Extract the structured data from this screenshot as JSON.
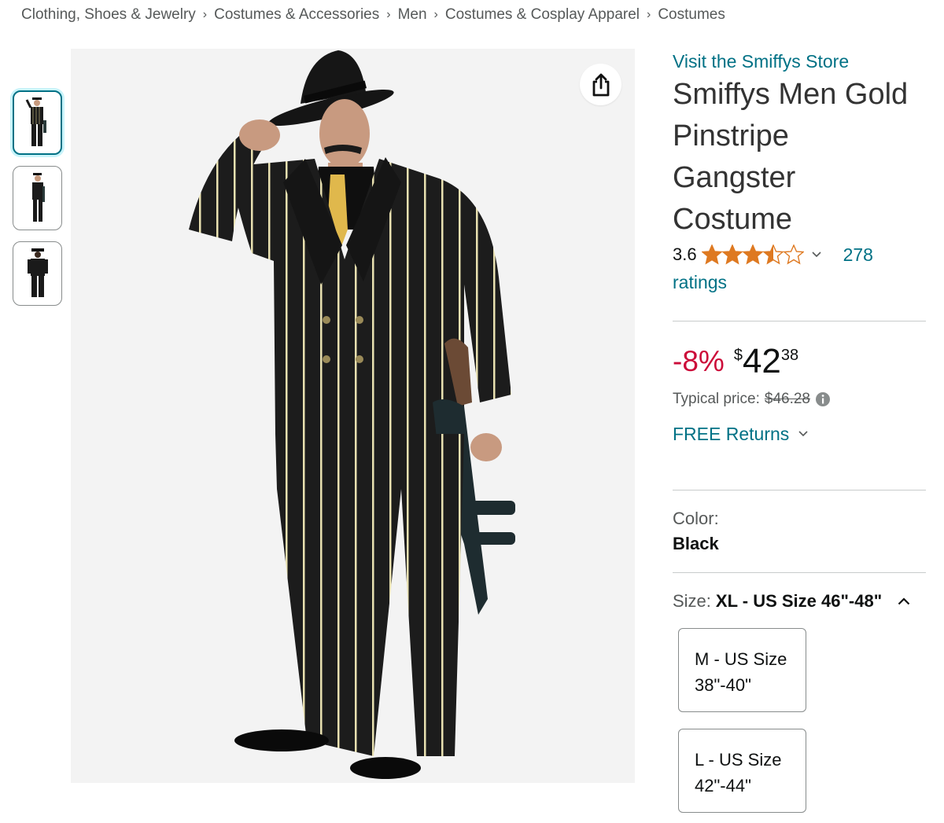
{
  "breadcrumb": [
    "Clothing, Shoes & Jewelry",
    "Costumes & Accessories",
    "Men",
    "Costumes & Cosplay Apparel",
    "Costumes"
  ],
  "breadcrumb_separator": "›",
  "icons": {
    "share": "share-icon",
    "star": "star-icon",
    "info": "info-icon",
    "chevron_down": "chevron-down-icon",
    "chevron_up": "chevron-up-icon"
  },
  "product": {
    "store_link": "Visit the Smiffys Store",
    "title_lines": [
      "Smiffys Men Gold",
      "Pinstripe",
      "Gangster",
      "Costume"
    ],
    "rating": {
      "value": "3.6",
      "stars": 3.6,
      "count": "278",
      "count_suffix": "ratings"
    },
    "price": {
      "discount": "-8%",
      "currency": "$",
      "whole": "42",
      "fraction": "38",
      "typical_label": "Typical price:",
      "typical_value": "$46.28"
    },
    "returns": "FREE Returns",
    "color": {
      "label": "Color:",
      "value": "Black"
    },
    "size": {
      "label": "Size:",
      "value": "XL - US Size 46\"-48\"",
      "options": [
        {
          "line1": "M - US Size",
          "line2": "38\"-40\""
        },
        {
          "line1": "L - US Size",
          "line2": "42\"-44\""
        }
      ]
    }
  },
  "colors": {
    "link": "#007185",
    "discount": "#cc0c39",
    "star": "#de7921",
    "selected_thumb_border": "#007185",
    "image_bg": "#f3f3f3"
  }
}
